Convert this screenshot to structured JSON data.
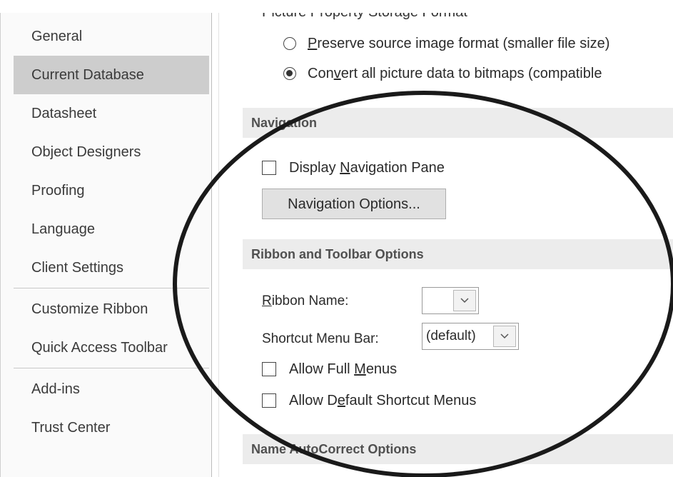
{
  "sidebar": {
    "items": [
      {
        "label": "General"
      },
      {
        "label": "Current Database"
      },
      {
        "label": "Datasheet"
      },
      {
        "label": "Object Designers"
      },
      {
        "label": "Proofing"
      },
      {
        "label": "Language"
      },
      {
        "label": "Client Settings"
      },
      {
        "label": "Customize Ribbon"
      },
      {
        "label": "Quick Access Toolbar"
      },
      {
        "label": "Add-ins"
      },
      {
        "label": "Trust Center"
      }
    ],
    "selected": "Current Database"
  },
  "picture_storage": {
    "heading": "Picture Property Storage Format",
    "options": [
      {
        "pre": "",
        "accel": "P",
        "post": "reserve source image format (smaller file size)",
        "checked": false
      },
      {
        "pre": "Con",
        "accel": "v",
        "post": "ert all picture data to bitmaps (compatible",
        "checked": true
      }
    ]
  },
  "navigation": {
    "section_title": "Navigation",
    "display_pane": {
      "pre": "Display ",
      "accel": "N",
      "post": "avigation Pane",
      "checked": false
    },
    "options_button": "Navigation Options..."
  },
  "ribbon": {
    "section_title": "Ribbon and Toolbar Options",
    "ribbon_name": {
      "accel": "R",
      "post": "ibbon Name:",
      "value": ""
    },
    "shortcut_menu_bar": {
      "label": "Shortcut Menu Bar:",
      "value": "(default)"
    },
    "allow_full_menus": {
      "pre": "Allow Full ",
      "accel": "M",
      "post": "enus",
      "checked": false
    },
    "allow_default_shortcut": {
      "pre": "Allow D",
      "accel": "e",
      "post": "fault Shortcut Menus",
      "checked": false
    }
  },
  "autocorrect": {
    "section_title": "Name AutoCorrect Options"
  },
  "colors": {
    "selected_bg": "#cdcdcd",
    "section_bg": "#ececec",
    "circle": "#1a1a1a"
  }
}
